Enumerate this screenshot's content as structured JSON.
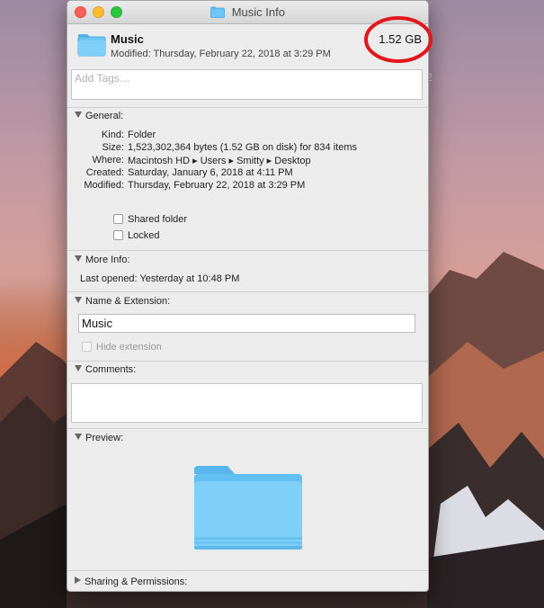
{
  "window": {
    "title": "Music Info"
  },
  "header": {
    "name": "Music",
    "modified": "Modified: Thursday, February 22, 2018 at 3:29 PM",
    "size": "1.52 GB"
  },
  "tags": {
    "placeholder": "Add Tags…"
  },
  "general": {
    "label": "General:",
    "rows": [
      {
        "key": "Kind:",
        "value": "Folder"
      },
      {
        "key": "Size:",
        "value": "1,523,302,364 bytes (1.52 GB on disk) for 834 items"
      },
      {
        "key": "Where:",
        "value": "Macintosh HD ▸ Users ▸ Smitty ▸ Desktop"
      },
      {
        "key": "Created:",
        "value": "Saturday, January 6, 2018 at 4:11 PM"
      },
      {
        "key": "Modified:",
        "value": "Thursday, February 22, 2018 at 3:29 PM"
      }
    ],
    "shared_folder_label": "Shared folder",
    "locked_label": "Locked"
  },
  "more_info": {
    "label": "More Info:",
    "last_opened_key": "Last opened:",
    "last_opened_value": "Yesterday at 10:48 PM"
  },
  "name_extension": {
    "label": "Name & Extension:",
    "value": "Music",
    "hide_extension_label": "Hide extension"
  },
  "comments": {
    "label": "Comments:"
  },
  "preview": {
    "label": "Preview:"
  },
  "sharing": {
    "label": "Sharing & Permissions:"
  },
  "background": {
    "stray_text": "2"
  },
  "colors": {
    "folder": "#6cc5f5",
    "annotation_ring": "#e3161c"
  }
}
